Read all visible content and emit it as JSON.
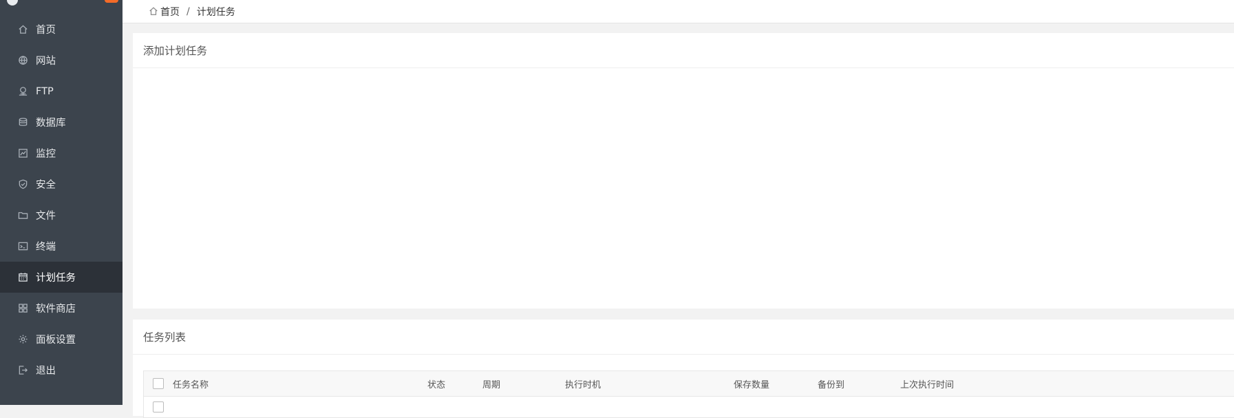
{
  "sidebar": {
    "items": [
      {
        "label": "首页",
        "icon": "home-icon"
      },
      {
        "label": "网站",
        "icon": "globe-icon"
      },
      {
        "label": "FTP",
        "icon": "ftp-icon"
      },
      {
        "label": "数据库",
        "icon": "database-icon"
      },
      {
        "label": "监控",
        "icon": "monitor-icon"
      },
      {
        "label": "安全",
        "icon": "shield-icon"
      },
      {
        "label": "文件",
        "icon": "folder-icon"
      },
      {
        "label": "终端",
        "icon": "terminal-icon"
      },
      {
        "label": "计划任务",
        "icon": "calendar-icon"
      },
      {
        "label": "软件商店",
        "icon": "apps-icon"
      },
      {
        "label": "面板设置",
        "icon": "gear-icon"
      },
      {
        "label": "退出",
        "icon": "logout-icon"
      }
    ],
    "active_index": 8
  },
  "breadcrumb": {
    "home": "首页",
    "separator": "/",
    "current": "计划任务"
  },
  "add_panel": {
    "title": "添加计划任务"
  },
  "list_panel": {
    "title": "任务列表",
    "columns": [
      "任务名称",
      "状态",
      "周期",
      "执行时机",
      "保存数量",
      "备份到",
      "上次执行时间"
    ]
  },
  "colors": {
    "sidebar": "#3c444d",
    "sidebar_active": "#2c3138",
    "accent": "#20a53a",
    "badge": "#f46b28"
  }
}
